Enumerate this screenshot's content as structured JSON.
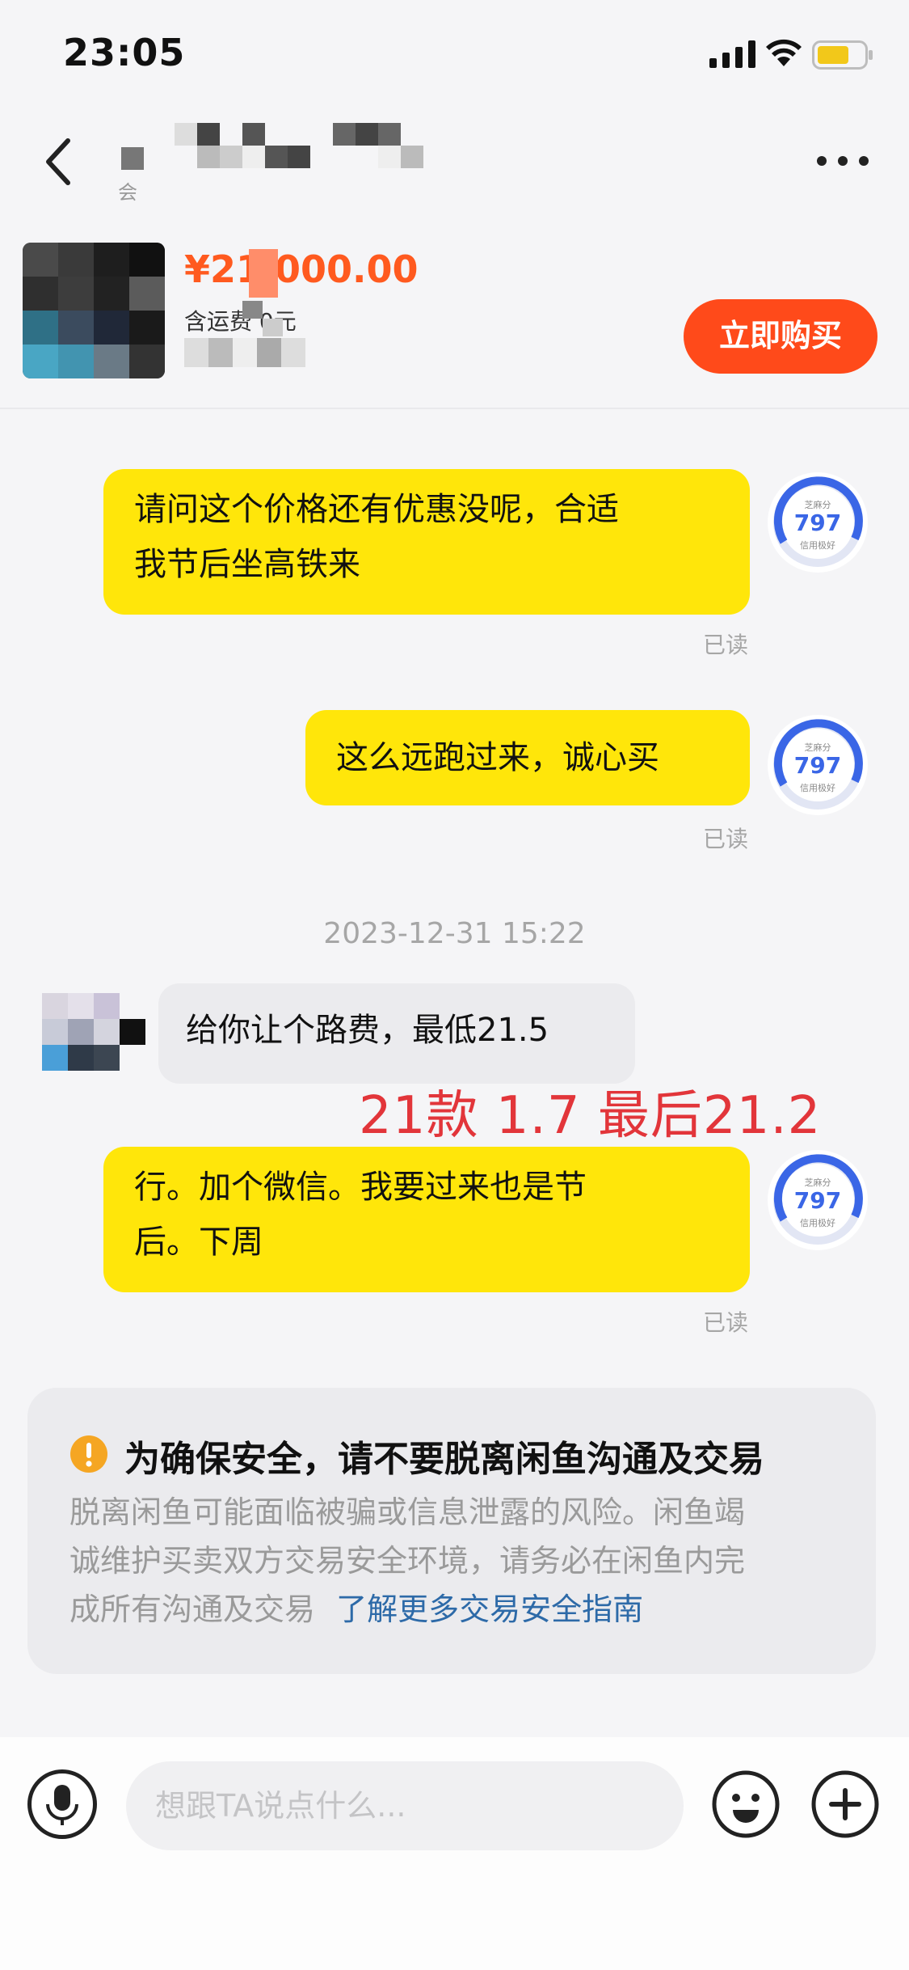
{
  "status_bar": {
    "time": "23:05"
  },
  "nav": {
    "subtitle": "会"
  },
  "product": {
    "price": "¥21 000.00",
    "shipping": "含运费  0元",
    "buy_label": "立即购买"
  },
  "chat": {
    "messages": [
      {
        "side": "out",
        "text_line1": "请问这个价格还有优惠没呢，合适",
        "text_line2": "我节后坐高铁来",
        "status": "已读",
        "score": "797"
      },
      {
        "side": "out",
        "text_line1": "这么远跑过来，诚心买",
        "status": "已读",
        "score": "797"
      },
      {
        "side": "in",
        "text_line1": "给你让个路费，最低21.5"
      },
      {
        "side": "out",
        "text_line1": "行。加个微信。我要过来也是节",
        "text_line2": "后。下周",
        "status": "已读",
        "score": "797"
      }
    ],
    "timestamp": "2023-12-31 15:22",
    "annotation": "21款 1.7 最后21.2",
    "score_label_top": "芝麻分",
    "score_label_bottom": "信用极好"
  },
  "safety_card": {
    "title": "为确保安全，请不要脱离闲鱼沟通及交易",
    "body_line1": "脱离闲鱼可能面临被骗或信息泄露的风险。闲鱼竭",
    "body_line2": "诚维护买卖双方交易安全环境，请务必在闲鱼内完",
    "body_line3": "成所有沟通及交易",
    "link": "了解更多交易安全指南"
  },
  "input_bar": {
    "placeholder": "想跟TA说点什么..."
  },
  "colors": {
    "accent_yellow": "#ffe60a",
    "buy_orange": "#ff4a1a",
    "price_orange": "#ff5a1f",
    "annotation_red": "#e2353a",
    "link_blue": "#2d6aa8"
  }
}
